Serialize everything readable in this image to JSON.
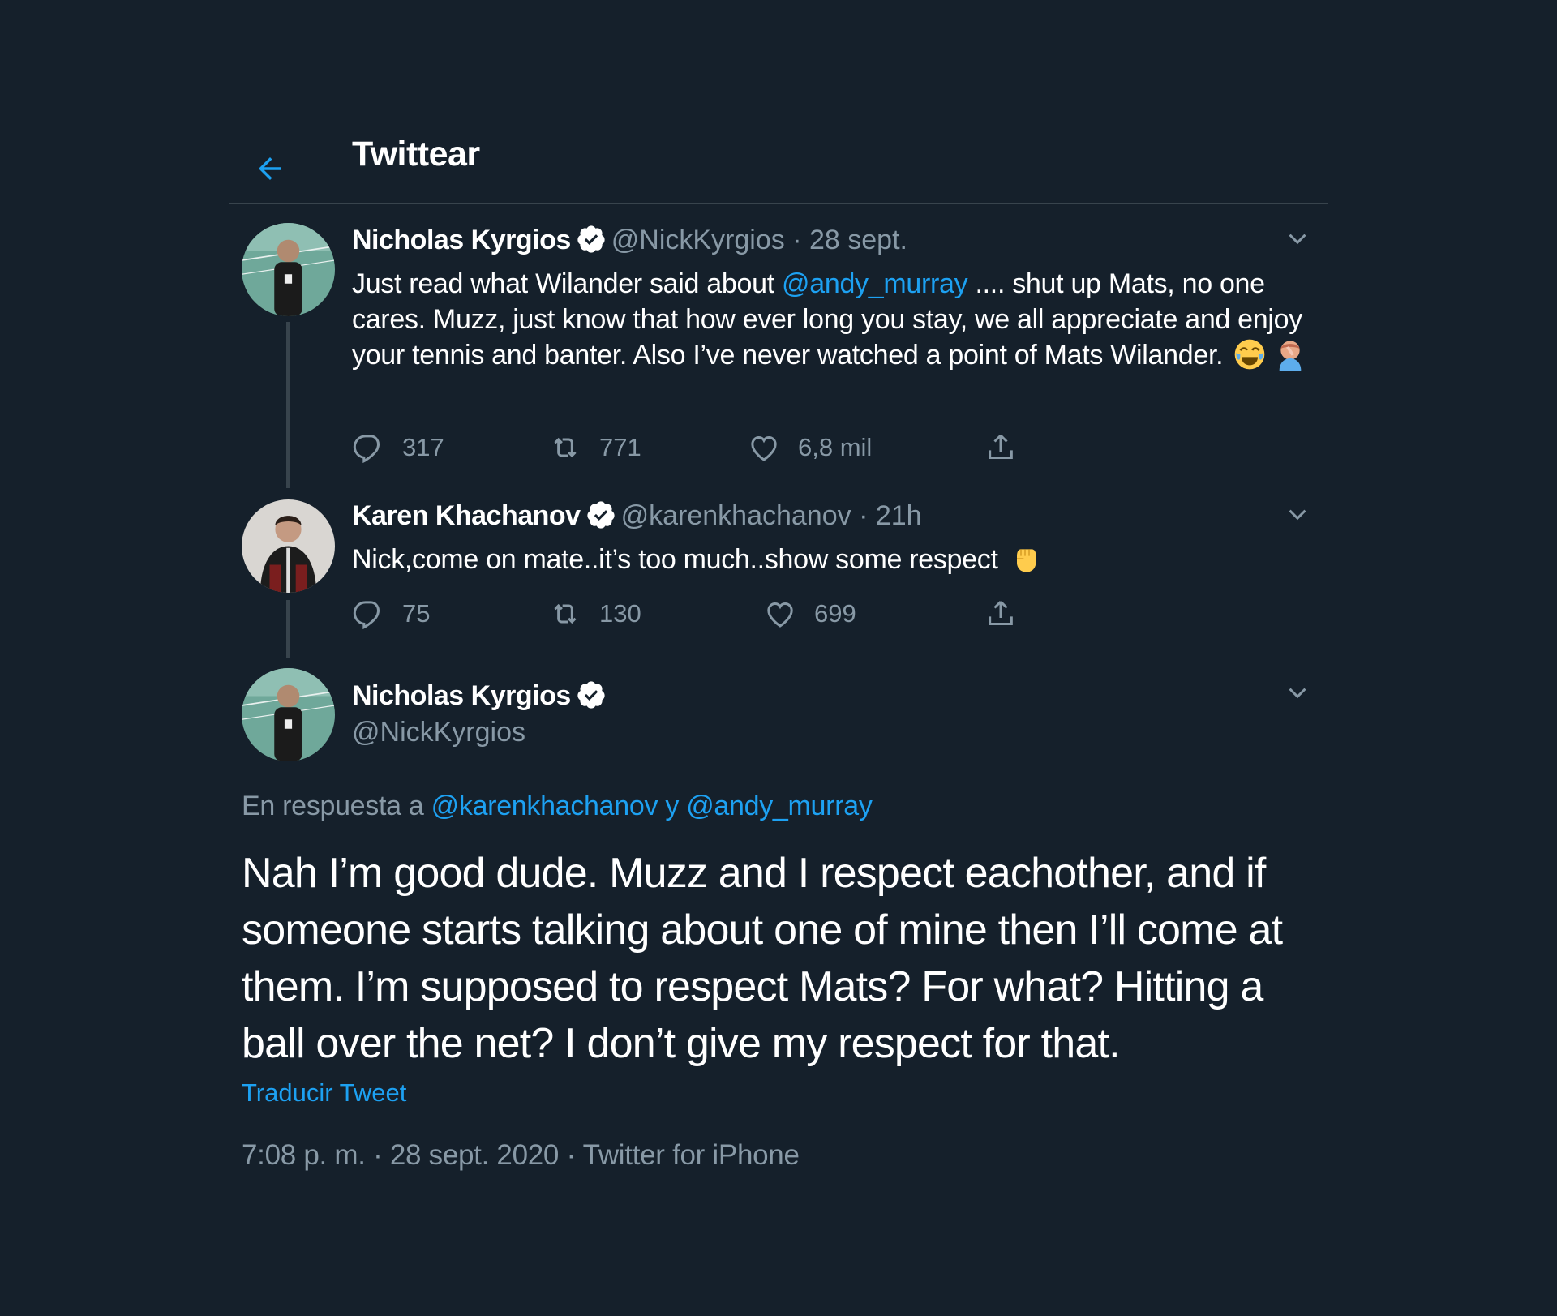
{
  "header": {
    "title": "Twittear"
  },
  "colors": {
    "background": "#15202b",
    "accent": "#1da1f2",
    "muted": "#8899a6",
    "divider": "#38444d"
  },
  "tweets": [
    {
      "name": "Nicholas Kyrgios",
      "handle": "@NickKyrgios",
      "sep": "·",
      "date": "28 sept.",
      "body_a": "Just read what Wilander said about ",
      "mention": "@andy_murray",
      "body_b": " .... shut up Mats, no one cares. Muzz, just know that how ever long you stay, we all appreciate and enjoy your tennis and banter. Also I’ve never watched a point of Mats Wilander.",
      "emojis": [
        "face-with-tears-of-joy-emoji",
        "man-facepalming-emoji"
      ],
      "replies": "317",
      "retweets": "771",
      "likes": "6,8 mil"
    },
    {
      "name": "Karen Khachanov",
      "handle": "@karenkhachanov",
      "sep": "·",
      "date": "21h",
      "body": "Nick,come on mate..it’s too much..show some respect",
      "emojis": [
        "raised-fist-emoji"
      ],
      "replies": "75",
      "retweets": "130",
      "likes": "699"
    }
  ],
  "main": {
    "name": "Nicholas Kyrgios",
    "handle": "@NickKyrgios",
    "reply_prefix": "En respuesta a ",
    "reply_mention1": "@karenkhachanov",
    "reply_and": " y ",
    "reply_mention2": "@andy_murray",
    "text": "Nah I’m good dude. Muzz and I respect eachother, and if someone starts talking about one of mine then I’ll come at them. I’m supposed to respect Mats? For what? Hitting a ball over the net? I don’t give my respect for that.",
    "translate": "Traducir Tweet",
    "time": "7:08 p. m.",
    "sep1": " · ",
    "date": "28 sept. 2020",
    "sep2": " · ",
    "source": "Twitter for iPhone"
  }
}
